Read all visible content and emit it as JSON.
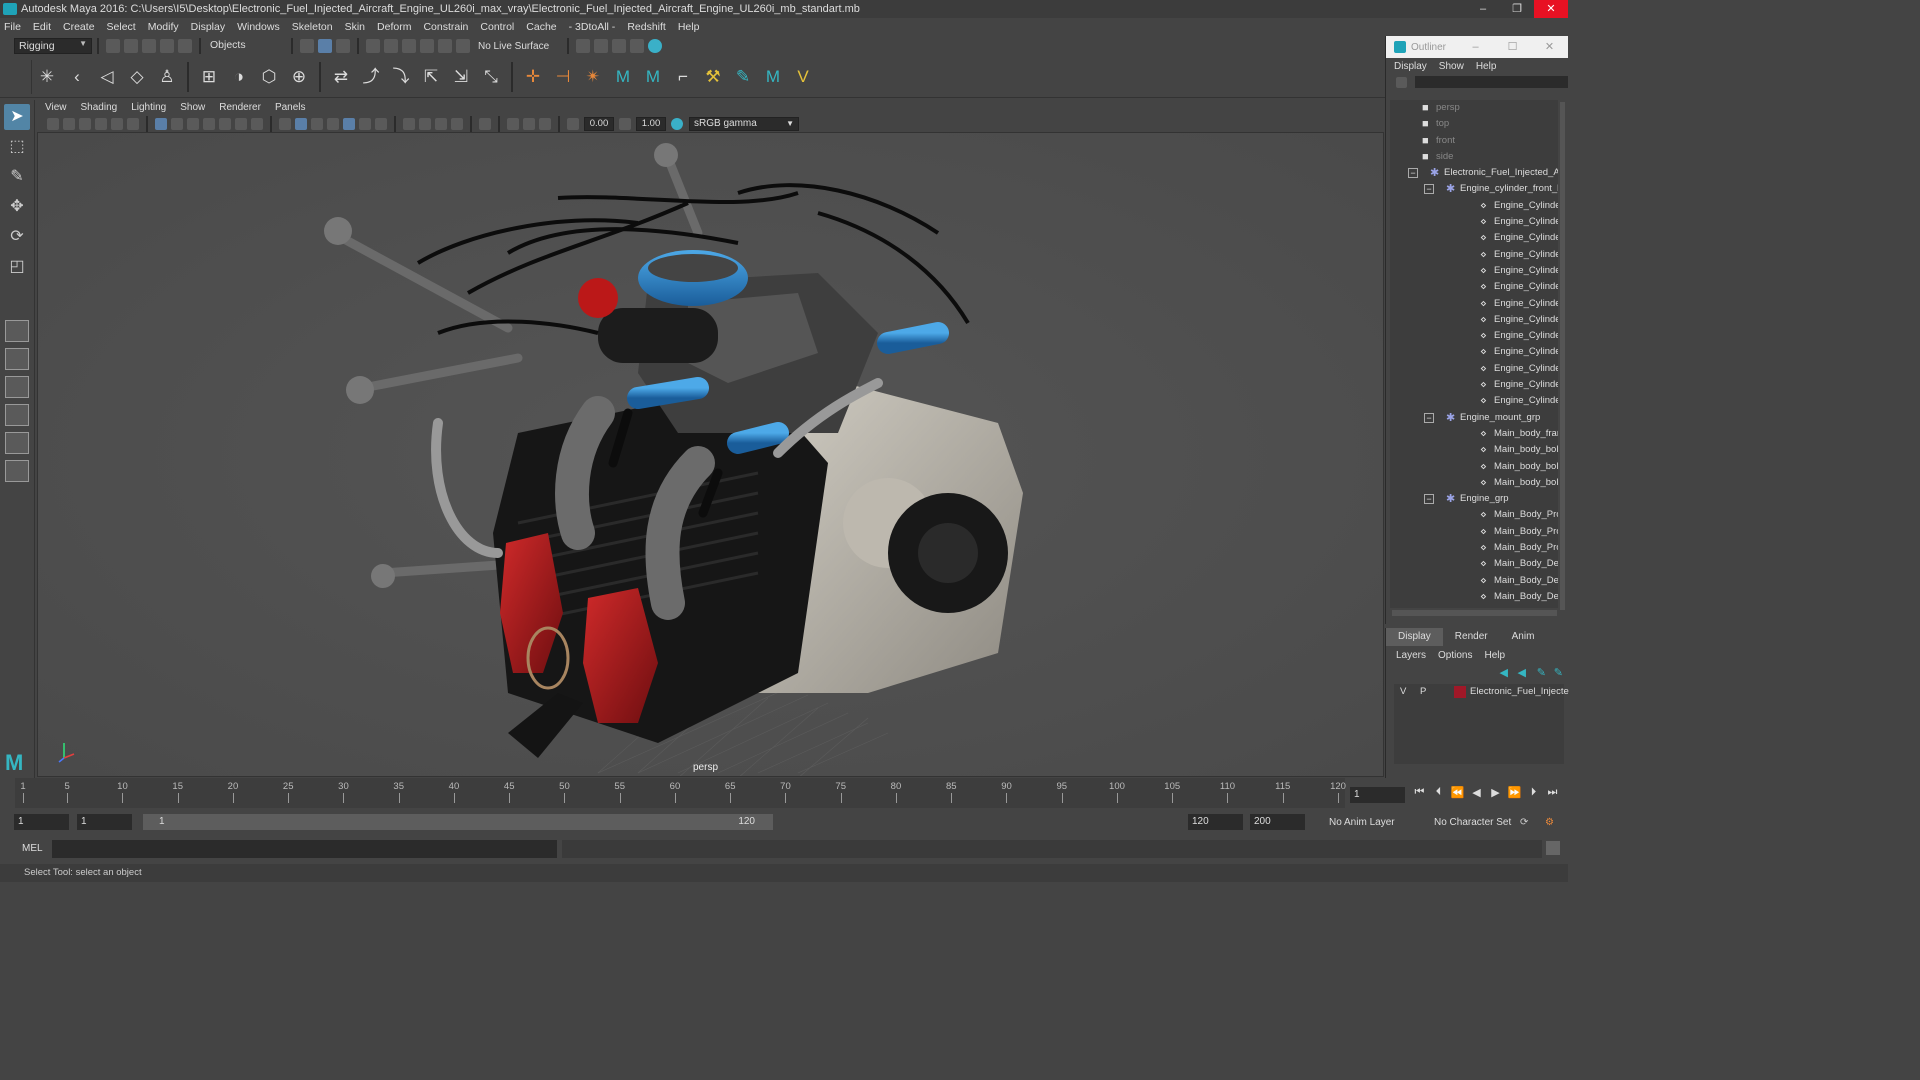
{
  "window": {
    "title": "Autodesk Maya 2016: C:\\Users\\I5\\Desktop\\Electronic_Fuel_Injected_Aircraft_Engine_UL260i_max_vray\\Electronic_Fuel_Injected_Aircraft_Engine_UL260i_mb_standart.mb",
    "min": "–",
    "max": "❐",
    "close": "✕"
  },
  "menubar": [
    "File",
    "Edit",
    "Create",
    "Select",
    "Modify",
    "Display",
    "Windows",
    "Skeleton",
    "Skin",
    "Deform",
    "Constrain",
    "Control",
    "Cache",
    "- 3DtoAll -",
    "Redshift",
    "Help"
  ],
  "statusline": {
    "menuset": "Rigging",
    "selection_mode": "Objects",
    "live_surface": "No Live Surface"
  },
  "viewport": {
    "menu": [
      "View",
      "Shading",
      "Lighting",
      "Show",
      "Renderer",
      "Panels"
    ],
    "exposure": "0.00",
    "gamma_value": "1.00",
    "color_space": "sRGB gamma",
    "camera": "persp"
  },
  "outliner": {
    "title": "Outliner",
    "menu": [
      "Display",
      "Show",
      "Help"
    ],
    "items": [
      {
        "label": "persp",
        "depth": 0,
        "type": "camera",
        "dim": true
      },
      {
        "label": "top",
        "depth": 0,
        "type": "camera",
        "dim": true
      },
      {
        "label": "front",
        "depth": 0,
        "type": "camera",
        "dim": true
      },
      {
        "label": "side",
        "depth": 0,
        "type": "camera",
        "dim": true
      },
      {
        "label": "Electronic_Fuel_Injected_Air",
        "depth": 0,
        "type": "group",
        "expanded": true
      },
      {
        "label": "Engine_cylinder_front_le",
        "depth": 1,
        "type": "group",
        "expanded": true
      },
      {
        "label": "Engine_Cylinder_ma",
        "depth": 2,
        "type": "mesh"
      },
      {
        "label": "Engine_Cylinder_air_",
        "depth": 2,
        "type": "mesh"
      },
      {
        "label": "Engine_Cylinder_gas",
        "depth": 2,
        "type": "mesh"
      },
      {
        "label": "Engine_Cylinder_mo",
        "depth": 2,
        "type": "mesh"
      },
      {
        "label": "Engine_Cylinder_ma",
        "depth": 2,
        "type": "mesh"
      },
      {
        "label": "Engine_Cylinder_ma",
        "depth": 2,
        "type": "mesh"
      },
      {
        "label": "Engine_Cylinder_car",
        "depth": 2,
        "type": "mesh"
      },
      {
        "label": "Engine_Cylinder_em",
        "depth": 2,
        "type": "mesh"
      },
      {
        "label": "Engine_Cylinder_gas",
        "depth": 2,
        "type": "mesh"
      },
      {
        "label": "Engine_Cylinder_bol",
        "depth": 2,
        "type": "mesh"
      },
      {
        "label": "Engine_Cylinder_ma",
        "depth": 2,
        "type": "mesh"
      },
      {
        "label": "Engine_Cylinder_bol",
        "depth": 2,
        "type": "mesh"
      },
      {
        "label": "Engine_Cylinder_air_",
        "depth": 2,
        "type": "mesh"
      },
      {
        "label": "Engine_mount_grp",
        "depth": 1,
        "type": "group",
        "expanded": true
      },
      {
        "label": "Main_body_frame",
        "depth": 2,
        "type": "mesh"
      },
      {
        "label": "Main_body_bolts_pa",
        "depth": 2,
        "type": "mesh"
      },
      {
        "label": "Main_body_bolts_pa",
        "depth": 2,
        "type": "mesh"
      },
      {
        "label": "Main_body_bolts_pa",
        "depth": 2,
        "type": "mesh"
      },
      {
        "label": "Engine_grp",
        "depth": 1,
        "type": "group",
        "expanded": true
      },
      {
        "label": "Main_Body_Propelle",
        "depth": 2,
        "type": "mesh"
      },
      {
        "label": "Main_Body_Propelle",
        "depth": 2,
        "type": "mesh"
      },
      {
        "label": "Main_Body_Propelle",
        "depth": 2,
        "type": "mesh"
      },
      {
        "label": "Main_Body_Details_f",
        "depth": 2,
        "type": "mesh"
      },
      {
        "label": "Main_Body_Details_f",
        "depth": 2,
        "type": "mesh"
      },
      {
        "label": "Main_Body_Details_f",
        "depth": 2,
        "type": "mesh"
      }
    ]
  },
  "layers": {
    "tabs": [
      "Display",
      "Render",
      "Anim"
    ],
    "menu": [
      "Layers",
      "Options",
      "Help"
    ],
    "rows": [
      {
        "v": "V",
        "p": "P",
        "color": "#a01828",
        "name": "Electronic_Fuel_Injecte"
      }
    ]
  },
  "timeline": {
    "ticks": [
      1,
      5,
      10,
      15,
      20,
      25,
      30,
      35,
      40,
      45,
      50,
      55,
      60,
      65,
      70,
      75,
      80,
      85,
      90,
      95,
      100,
      105,
      110,
      115,
      120
    ],
    "current_frame": "1"
  },
  "range": {
    "start": "1",
    "start_inner": "1",
    "range_start": "1",
    "range_end": "120",
    "end_inner": "120",
    "end": "200",
    "anim_layer": "No Anim Layer",
    "char_set": "No Character Set"
  },
  "command": {
    "label": "MEL"
  },
  "help": {
    "text": "Select Tool: select an object"
  }
}
